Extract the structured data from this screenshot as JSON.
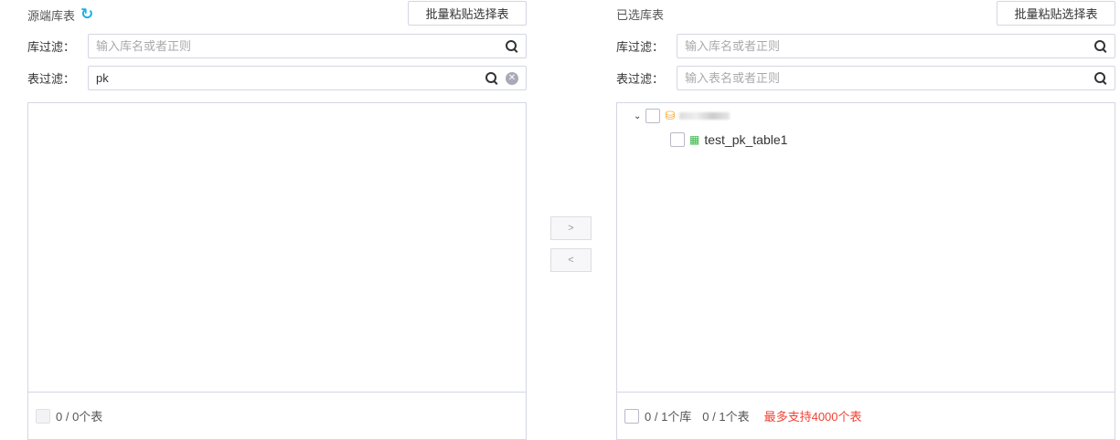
{
  "source": {
    "title": "源端库表",
    "batch_label": "批量粘贴选择表",
    "db_filter_label": "库过滤：",
    "db_filter_placeholder": "输入库名或者正则",
    "db_filter_value": "",
    "table_filter_label": "表过滤：",
    "table_filter_placeholder": "输入表名或者正则",
    "table_filter_value": "pk",
    "footer_count": "0 / 0个表"
  },
  "transfer": {
    "right_label": ">",
    "left_label": "<"
  },
  "target": {
    "title": "已选库表",
    "batch_label": "批量粘贴选择表",
    "db_filter_label": "库过滤：",
    "db_filter_placeholder": "输入库名或者正则",
    "table_filter_label": "表过滤：",
    "table_filter_placeholder": "输入表名或者正则",
    "tree": {
      "table": "test_pk_table1"
    },
    "footer_db_count": "0 / 1个库",
    "footer_table_count": "0 / 1个表",
    "limit_note": "最多支持4000个表"
  }
}
